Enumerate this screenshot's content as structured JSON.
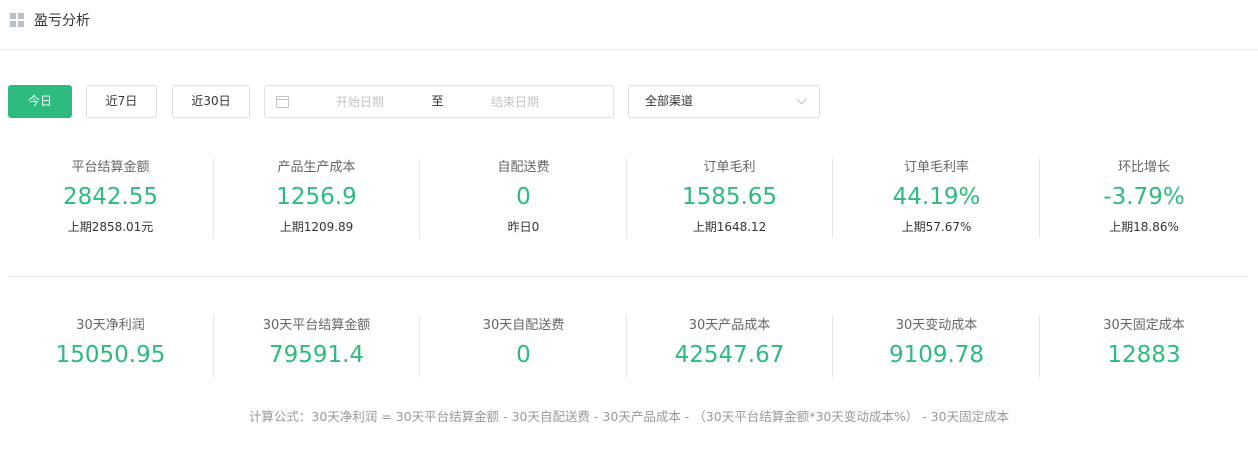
{
  "header": {
    "title": "盈亏分析",
    "icon": "grid-icon"
  },
  "toolbar": {
    "today_label": "今日",
    "last7_label": "近7日",
    "last30_label": "近30日",
    "date_start_placeholder": "开始日期",
    "date_separator": "至",
    "date_end_placeholder": "结束日期",
    "channel_value": "全部渠道"
  },
  "stats_top": [
    {
      "label": "平台结算金额",
      "value": "2842.55",
      "sub": "上期2858.01元"
    },
    {
      "label": "产品生产成本",
      "value": "1256.9",
      "sub": "上期1209.89"
    },
    {
      "label": "自配送费",
      "value": "0",
      "sub": "昨日0"
    },
    {
      "label": "订单毛利",
      "value": "1585.65",
      "sub": "上期1648.12"
    },
    {
      "label": "订单毛利率",
      "value": "44.19%",
      "sub": "上期57.67%"
    },
    {
      "label": "环比增长",
      "value": "-3.79%",
      "sub": "上期18.86%"
    }
  ],
  "stats_bottom": [
    {
      "label": "30天净利润",
      "value": "15050.95"
    },
    {
      "label": "30天平台结算金额",
      "value": "79591.4"
    },
    {
      "label": "30天自配送费",
      "value": "0"
    },
    {
      "label": "30天产品成本",
      "value": "42547.67"
    },
    {
      "label": "30天变动成本",
      "value": "9109.78"
    },
    {
      "label": "30天固定成本",
      "value": "12883"
    }
  ],
  "formula": "计算公式：30天净利润 = 30天平台结算金额 - 30天自配送费 - 30天产品成本 - （30天平台结算金额*30天变动成本%） - 30天固定成本",
  "colors": {
    "accent": "#2dbb7f",
    "border": "#dcdfe6"
  }
}
